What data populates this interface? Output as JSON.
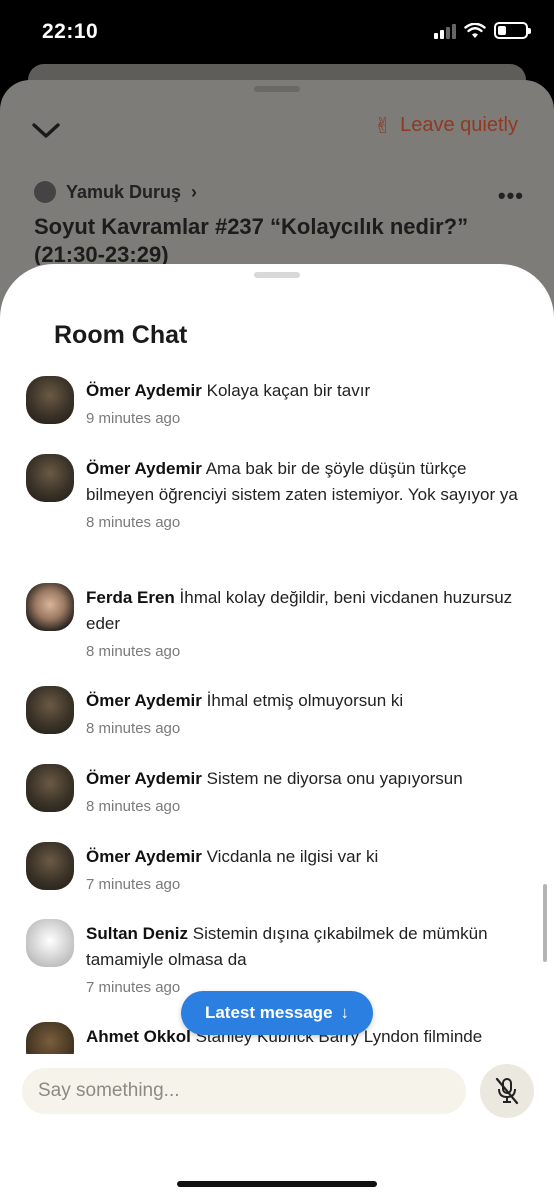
{
  "status": {
    "time": "22:10"
  },
  "room": {
    "leave_label": "Leave quietly",
    "club_name": "Yamuk Duruş",
    "title": "Soyut Kavramlar #237 “Kolaycılık nedir?” (21:30-23:29)"
  },
  "chat": {
    "title": "Room Chat",
    "messages": [
      {
        "name": "Ömer Aydemir",
        "text": "Kolaya kaçan bir tavır",
        "time": "9 minutes ago"
      },
      {
        "name": "Ömer Aydemir",
        "text": "Ama bak bir de şöyle düşün türkçe bilmeyen öğrenciyi sistem zaten istemiyor. Yok sayıyor ya",
        "time": "8 minutes ago"
      },
      {
        "name": "Ferda Eren",
        "text": "İhmal kolay değildir, beni vicdanen huzursuz eder",
        "time": "8 minutes ago"
      },
      {
        "name": "Ömer Aydemir",
        "text": "İhmal etmiş olmuyorsun ki",
        "time": "8 minutes ago"
      },
      {
        "name": "Ömer Aydemir",
        "text": "Sistem ne diyorsa onu yapıyorsun",
        "time": "8 minutes ago"
      },
      {
        "name": "Ömer Aydemir",
        "text": "Vicdanla ne ilgisi var ki",
        "time": "7 minutes ago"
      },
      {
        "name": "Sultan Deniz",
        "text": "Sistemin dışına çıkabilmek de mümkün tamamiyle olmasa da",
        "time": "7 minutes ago"
      },
      {
        "name": "Ahmet Okkol",
        "text": "Stanley Kubrick Barry Lyndon filminde",
        "time": ""
      }
    ],
    "latest_label": "Latest message",
    "compose_placeholder": "Say something..."
  },
  "colors": {
    "accent": "#2a7fe0",
    "leave": "#c0502c"
  },
  "icons": {
    "collapse": "chevron-down-icon",
    "leave": "peace-hand-icon",
    "more": "more-dots-icon",
    "mic": "mic-off-icon",
    "latest": "arrow-down-icon"
  }
}
